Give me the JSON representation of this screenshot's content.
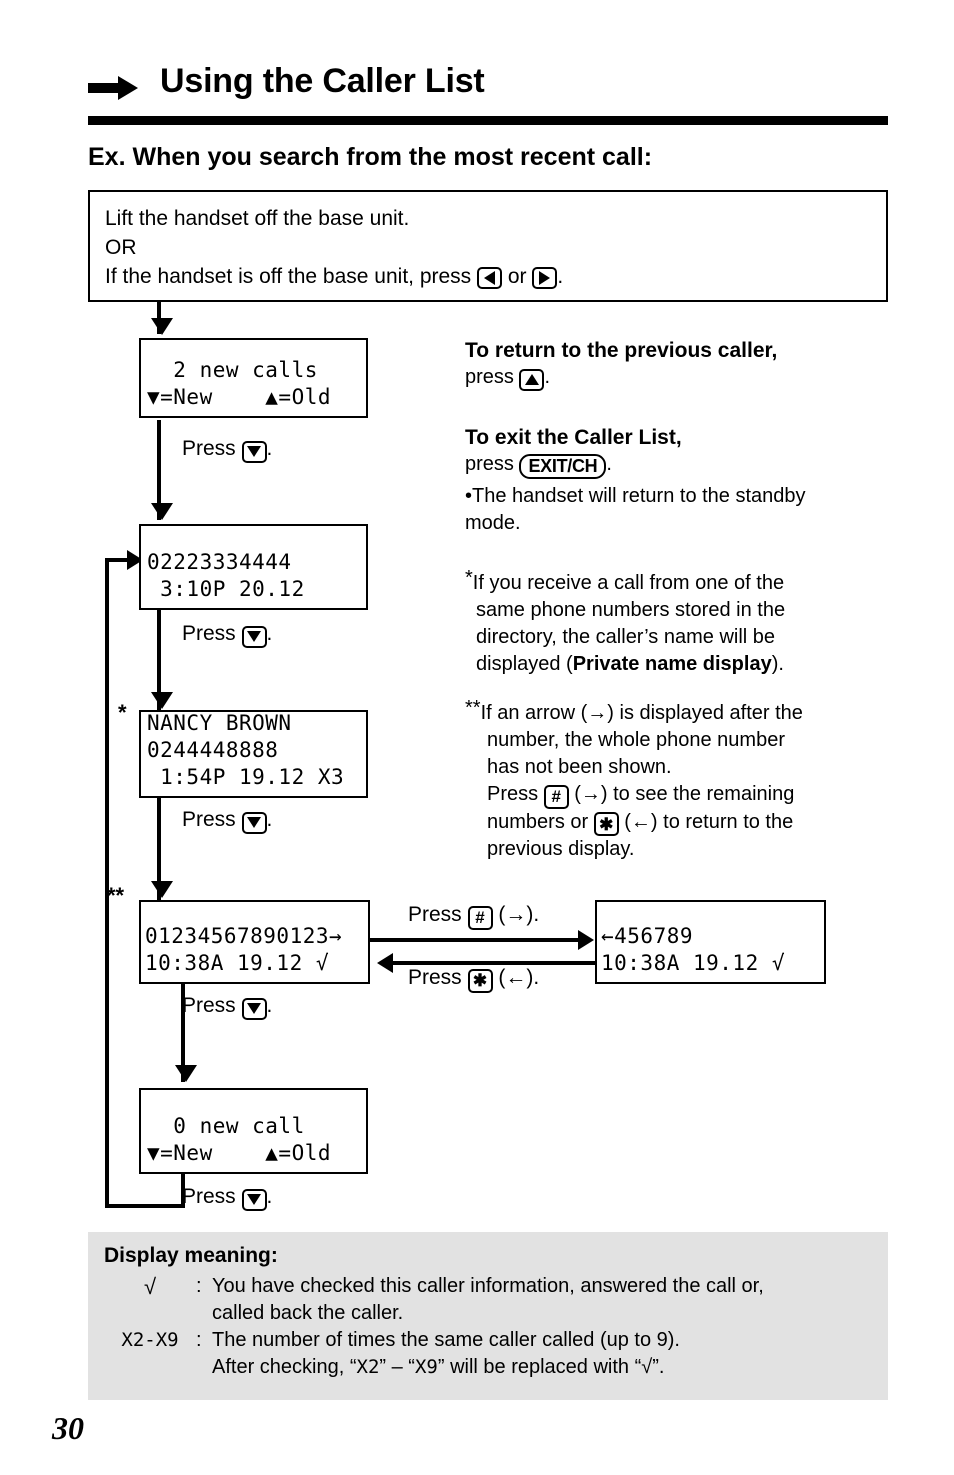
{
  "header": {
    "title": "Using the Caller List",
    "arrow_icon": "right-arrow-icon",
    "section_heading": "Ex. When you search from the most recent call:"
  },
  "intro": {
    "line1": "Lift the handset off the base unit.",
    "line2": "OR",
    "line3_a": "If the handset is off the base unit, press ",
    "line3_b": " or ",
    "line3_c": ".",
    "key_left": "left-arrow-key",
    "key_right": "right-arrow-key"
  },
  "flow": {
    "displays": [
      {
        "id": "display-2-new-calls",
        "lines": [
          "  2 new calls",
          "▼=New    ▲=Old"
        ]
      },
      {
        "id": "display-caller-1",
        "lines": [
          "02223334444",
          " 3:10P 20.12"
        ]
      },
      {
        "id": "display-caller-2",
        "lines": [
          "NANCY BROWN",
          "0244448888",
          " 1:54P 19.12 X3"
        ]
      },
      {
        "id": "display-caller-3",
        "lines": [
          "01234567890123→",
          "10:38A 19.12 √"
        ]
      },
      {
        "id": "display-caller-3-scrolled",
        "lines": [
          "←456789",
          "10:38A 19.12 √"
        ]
      },
      {
        "id": "display-0-new-call",
        "lines": [
          "  0 new call",
          "▼=New    ▲=Old"
        ]
      }
    ],
    "press_down_label": "Press",
    "press_down_suffix": ".",
    "press_hash_label": "Press",
    "press_hash_suffix": "(→).",
    "press_star_label": "Press",
    "press_star_suffix": "(←).",
    "hash_key": "#",
    "star_key": "✱",
    "marker_single": "*",
    "marker_double": "**"
  },
  "notes": {
    "return_title": "To return to the previous caller,",
    "return_press": "press ",
    "return_suffix": ".",
    "exit_title": "To exit the Caller List,",
    "exit_press": "press ",
    "exit_key": "EXIT/CH",
    "exit_suffix": ".",
    "exit_bullet": "•The handset will return to the standby",
    "exit_bullet_cont": " mode.",
    "star_note_l1": "If you receive a call from one of the",
    "star_note_l2": "same phone numbers stored in the",
    "star_note_l3": "directory, the caller’s name will be",
    "star_note_l4a": "displayed (",
    "star_note_l4b": "Private name display",
    "star_note_l4c": ").",
    "dstar_note_l1": "If an arrow (→) is displayed after the",
    "dstar_note_l2": "number, the whole phone number",
    "dstar_note_l3": "has not been shown.",
    "dstar_note_l4a": "Press ",
    "dstar_note_l4b": " (→) to see the remaining",
    "dstar_note_l5a": "numbers or ",
    "dstar_note_l5b": " (←) to return to the",
    "dstar_note_l6": "previous display."
  },
  "display_meaning": {
    "title": "Display meaning:",
    "row1_symbol": "√",
    "row1_colon": ":",
    "row1_text": "You have checked this caller information, answered the call or,",
    "row1_cont": "called back the caller.",
    "row2_symbol": "X2-X9",
    "row2_colon": ":",
    "row2_text": "The number of times the same caller called (up to 9).",
    "row2_cont_a": "After checking, “",
    "row2_cont_sym1": "X2",
    "row2_cont_b": "” – “",
    "row2_cont_sym2": "X9",
    "row2_cont_c": "” will be replaced with “√”."
  },
  "footer": {
    "page_number": "30"
  }
}
